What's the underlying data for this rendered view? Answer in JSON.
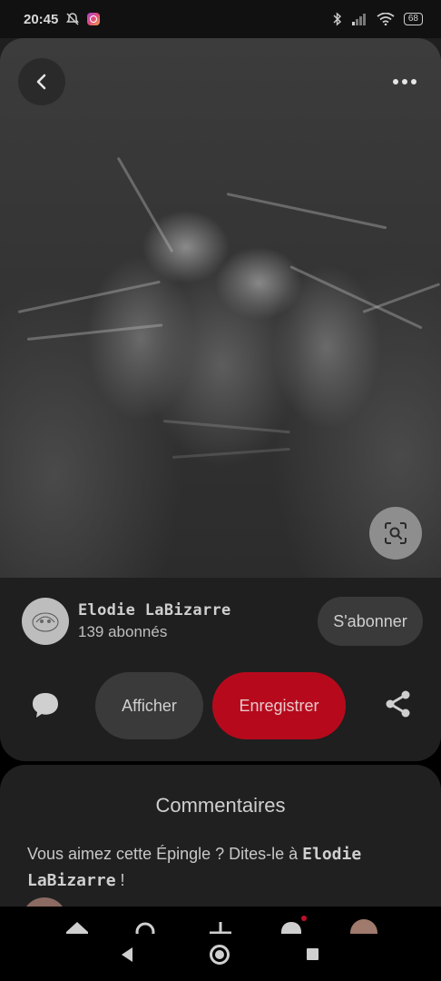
{
  "status_bar": {
    "time": "20:45",
    "battery": "68",
    "icons": [
      "mute-alarm-icon",
      "instagram-icon",
      "bluetooth-icon",
      "signal-icon",
      "wifi-icon",
      "battery-icon"
    ]
  },
  "pin": {
    "image_description_icon": "pin-photo",
    "lens_icon": "visual-search-icon"
  },
  "creator": {
    "name": "Elodie LaBizarre",
    "followers": "139 abonnés",
    "follow_label": "S'abonner"
  },
  "actions": {
    "view_label": "Afficher",
    "save_label": "Enregistrer",
    "save_color": "#b60a1c"
  },
  "comments": {
    "title": "Commentaires",
    "prompt_prefix": "Vous aimez cette Épingle ? Dites-le à ",
    "prompt_name": "Elodie LaBizarre",
    "prompt_suffix": " !"
  },
  "tab_bar": {
    "items": [
      "home-icon",
      "search-icon",
      "add-icon",
      "notifications-icon",
      "profile-avatar"
    ]
  }
}
